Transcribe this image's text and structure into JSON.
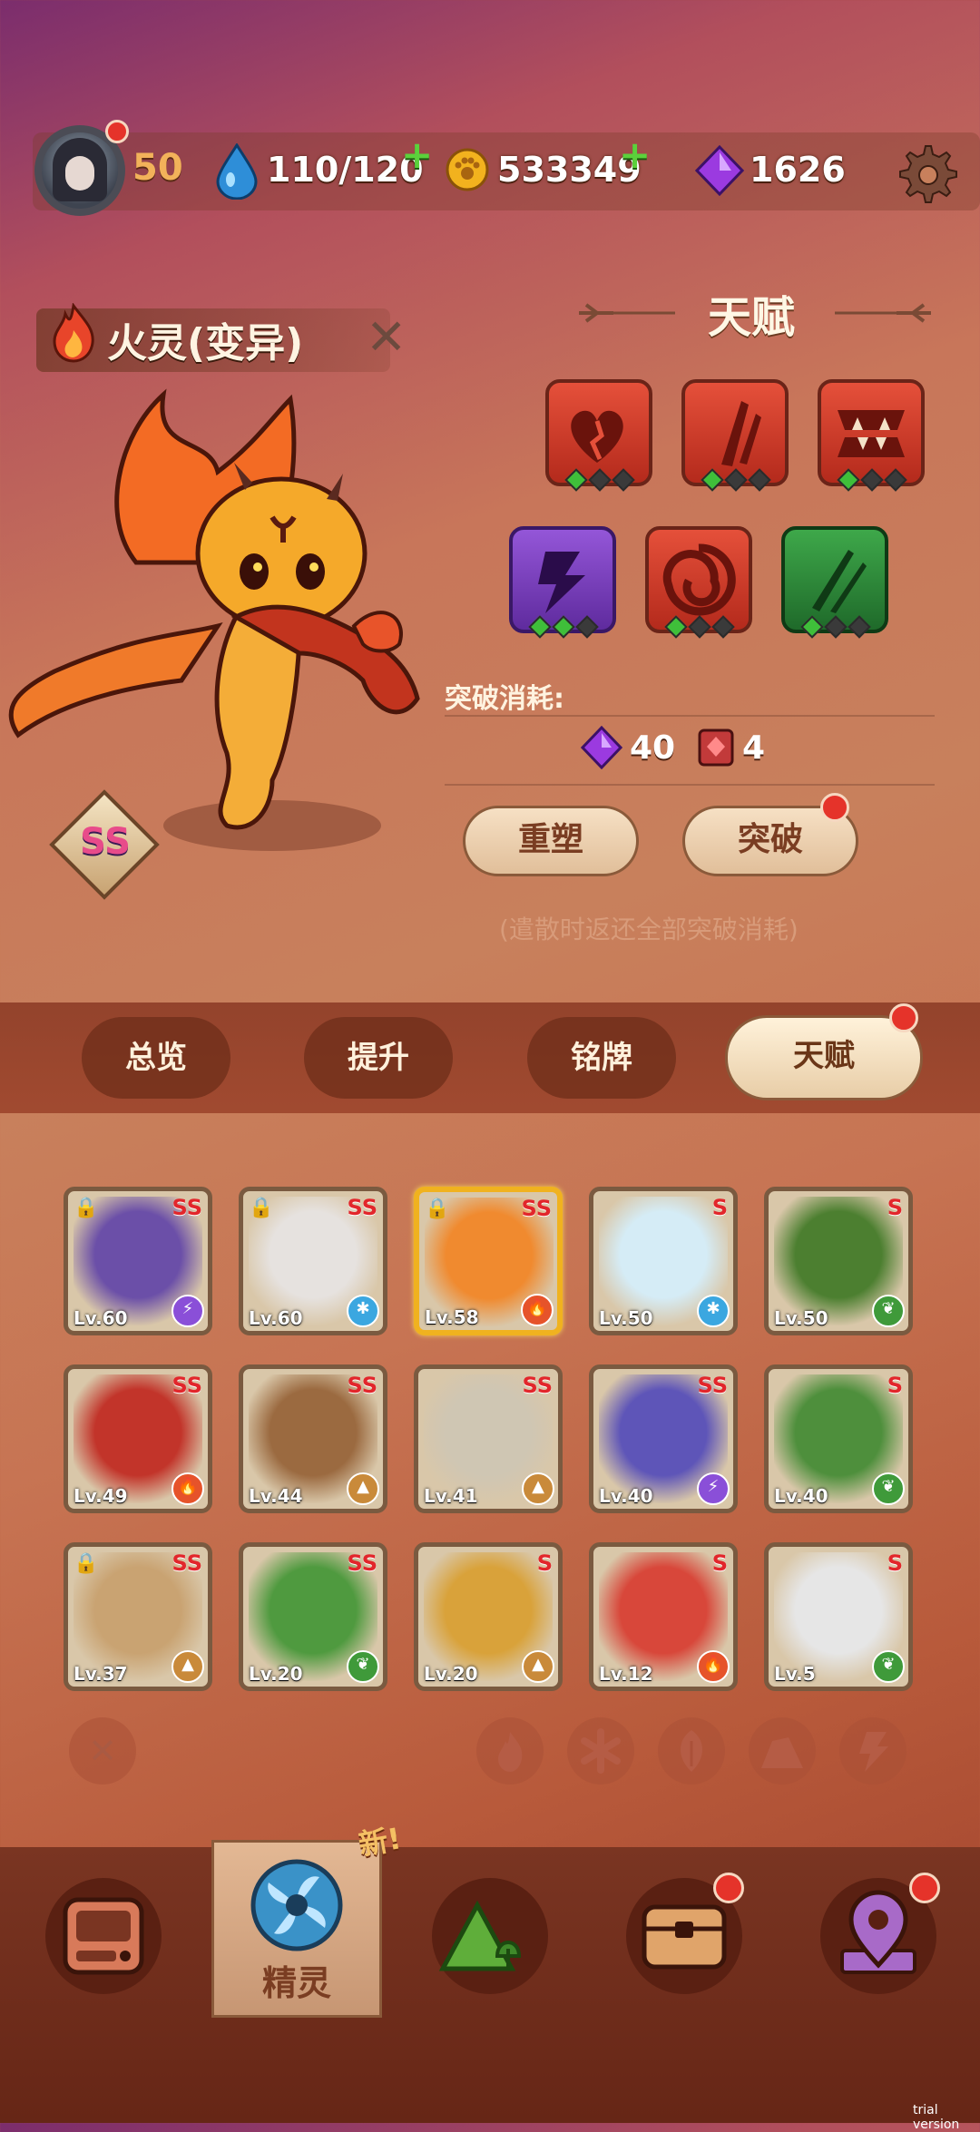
{
  "top_bar": {
    "player_level": "50",
    "stamina": "110/120",
    "coins": "533349",
    "gems": "1626",
    "plus_symbol": "+",
    "icons": {
      "stamina": "water-drop-icon",
      "coins": "paw-coin-icon",
      "gems": "purple-gem-icon",
      "settings": "gear-icon"
    }
  },
  "creature": {
    "name": "火灵(变异)",
    "rank": "SS",
    "close_symbol": "✕"
  },
  "talent": {
    "title": "天赋",
    "slots": [
      {
        "icon": "heart-split-icon",
        "color": "#c63a2a",
        "filled": 1
      },
      {
        "icon": "slash-icon",
        "color": "#c63a2a",
        "filled": 1
      },
      {
        "icon": "fang-icon",
        "color": "#c63a2a",
        "filled": 1
      },
      {
        "icon": "lightning-icon",
        "color": "#7c3fc2",
        "filled": 2
      },
      {
        "icon": "swirl-icon",
        "color": "#c63a2a",
        "filled": 1
      },
      {
        "icon": "claw-icon",
        "color": "#2e8a3a",
        "filled": 1
      }
    ],
    "breakthrough_cost_label": "突破消耗:",
    "cost_gem": "40",
    "cost_item": "4",
    "reshape_button": "重塑",
    "breakthrough_button": "突破",
    "note": "(遣散时返还全部突破消耗)"
  },
  "tabs": [
    {
      "label": "总览",
      "active": false
    },
    {
      "label": "提升",
      "active": false
    },
    {
      "label": "铭牌",
      "active": false
    },
    {
      "label": "天赋",
      "active": true
    }
  ],
  "roster": [
    {
      "level": "Lv.60",
      "rank": "SS",
      "element": "lightning",
      "locked": true,
      "color": "#6b4fa8"
    },
    {
      "level": "Lv.60",
      "rank": "SS",
      "element": "ice",
      "locked": true,
      "color": "#e6e2df"
    },
    {
      "level": "Lv.58",
      "rank": "SS",
      "element": "fire",
      "locked": true,
      "color": "#f08a2f",
      "selected": true
    },
    {
      "level": "Lv.50",
      "rank": "S",
      "element": "ice",
      "locked": false,
      "color": "#d5ecf6"
    },
    {
      "level": "Lv.50",
      "rank": "S",
      "element": "leaf",
      "locked": false,
      "color": "#4c7f30"
    },
    {
      "level": "Lv.49",
      "rank": "SS",
      "element": "fire",
      "locked": false,
      "color": "#c2342a"
    },
    {
      "level": "Lv.44",
      "rank": "SS",
      "element": "earth",
      "locked": false,
      "color": "#9b6a40"
    },
    {
      "level": "Lv.41",
      "rank": "SS",
      "element": "earth",
      "locked": false,
      "color": "#cfc6b3"
    },
    {
      "level": "Lv.40",
      "rank": "SS",
      "element": "lightning",
      "locked": false,
      "color": "#5e55b8"
    },
    {
      "level": "Lv.40",
      "rank": "S",
      "element": "leaf",
      "locked": false,
      "color": "#4e8f3c"
    },
    {
      "level": "Lv.37",
      "rank": "SS",
      "element": "earth",
      "locked": true,
      "color": "#c9a372"
    },
    {
      "level": "Lv.20",
      "rank": "SS",
      "element": "leaf",
      "locked": false,
      "color": "#4f9a3f"
    },
    {
      "level": "Lv.20",
      "rank": "S",
      "element": "earth",
      "locked": false,
      "color": "#d9a23a"
    },
    {
      "level": "Lv.12",
      "rank": "S",
      "element": "fire",
      "locked": false,
      "color": "#d8473a"
    },
    {
      "level": "Lv.5",
      "rank": "S",
      "element": "leaf",
      "locked": false,
      "color": "#e6e6e6"
    }
  ],
  "element_colors": {
    "fire": "#e6532a",
    "ice": "#3ba7e0",
    "leaf": "#3f9a3a",
    "earth": "#c98a3a",
    "lightning": "#8a4fd8"
  },
  "filters": {
    "clear_symbol": "✕",
    "fire": "fire-filter-icon",
    "ice": "snowflake-filter-icon",
    "leaf": "leaf-filter-icon",
    "earth": "rock-filter-icon",
    "lightning": "lightning-filter-icon"
  },
  "bottom_nav": {
    "active_label": "精灵",
    "new_badge": "新!",
    "items": [
      "console-icon",
      "spirit-swirl-icon",
      "mountain-icon",
      "chest-icon",
      "map-pin-icon"
    ]
  },
  "watermark": "trial version"
}
